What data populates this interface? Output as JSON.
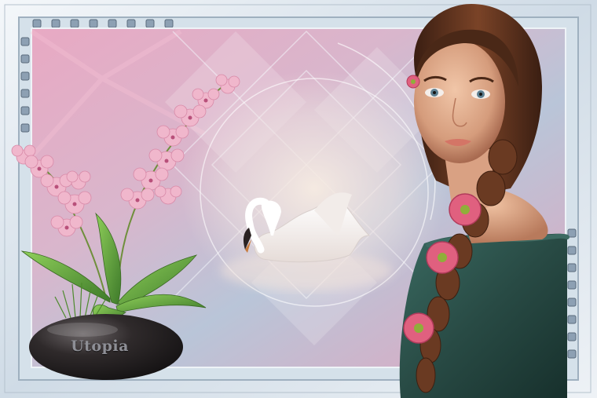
{
  "vase": {
    "label": "Utopia"
  },
  "colors": {
    "frame": "#d8e3ec",
    "background_pink": "#e7a3bf",
    "background_blue": "#b3c3d6",
    "dress": "#284a44",
    "hair": "#6a3a22",
    "orchid": "#f0b7cc",
    "vase": "#2a2526"
  }
}
